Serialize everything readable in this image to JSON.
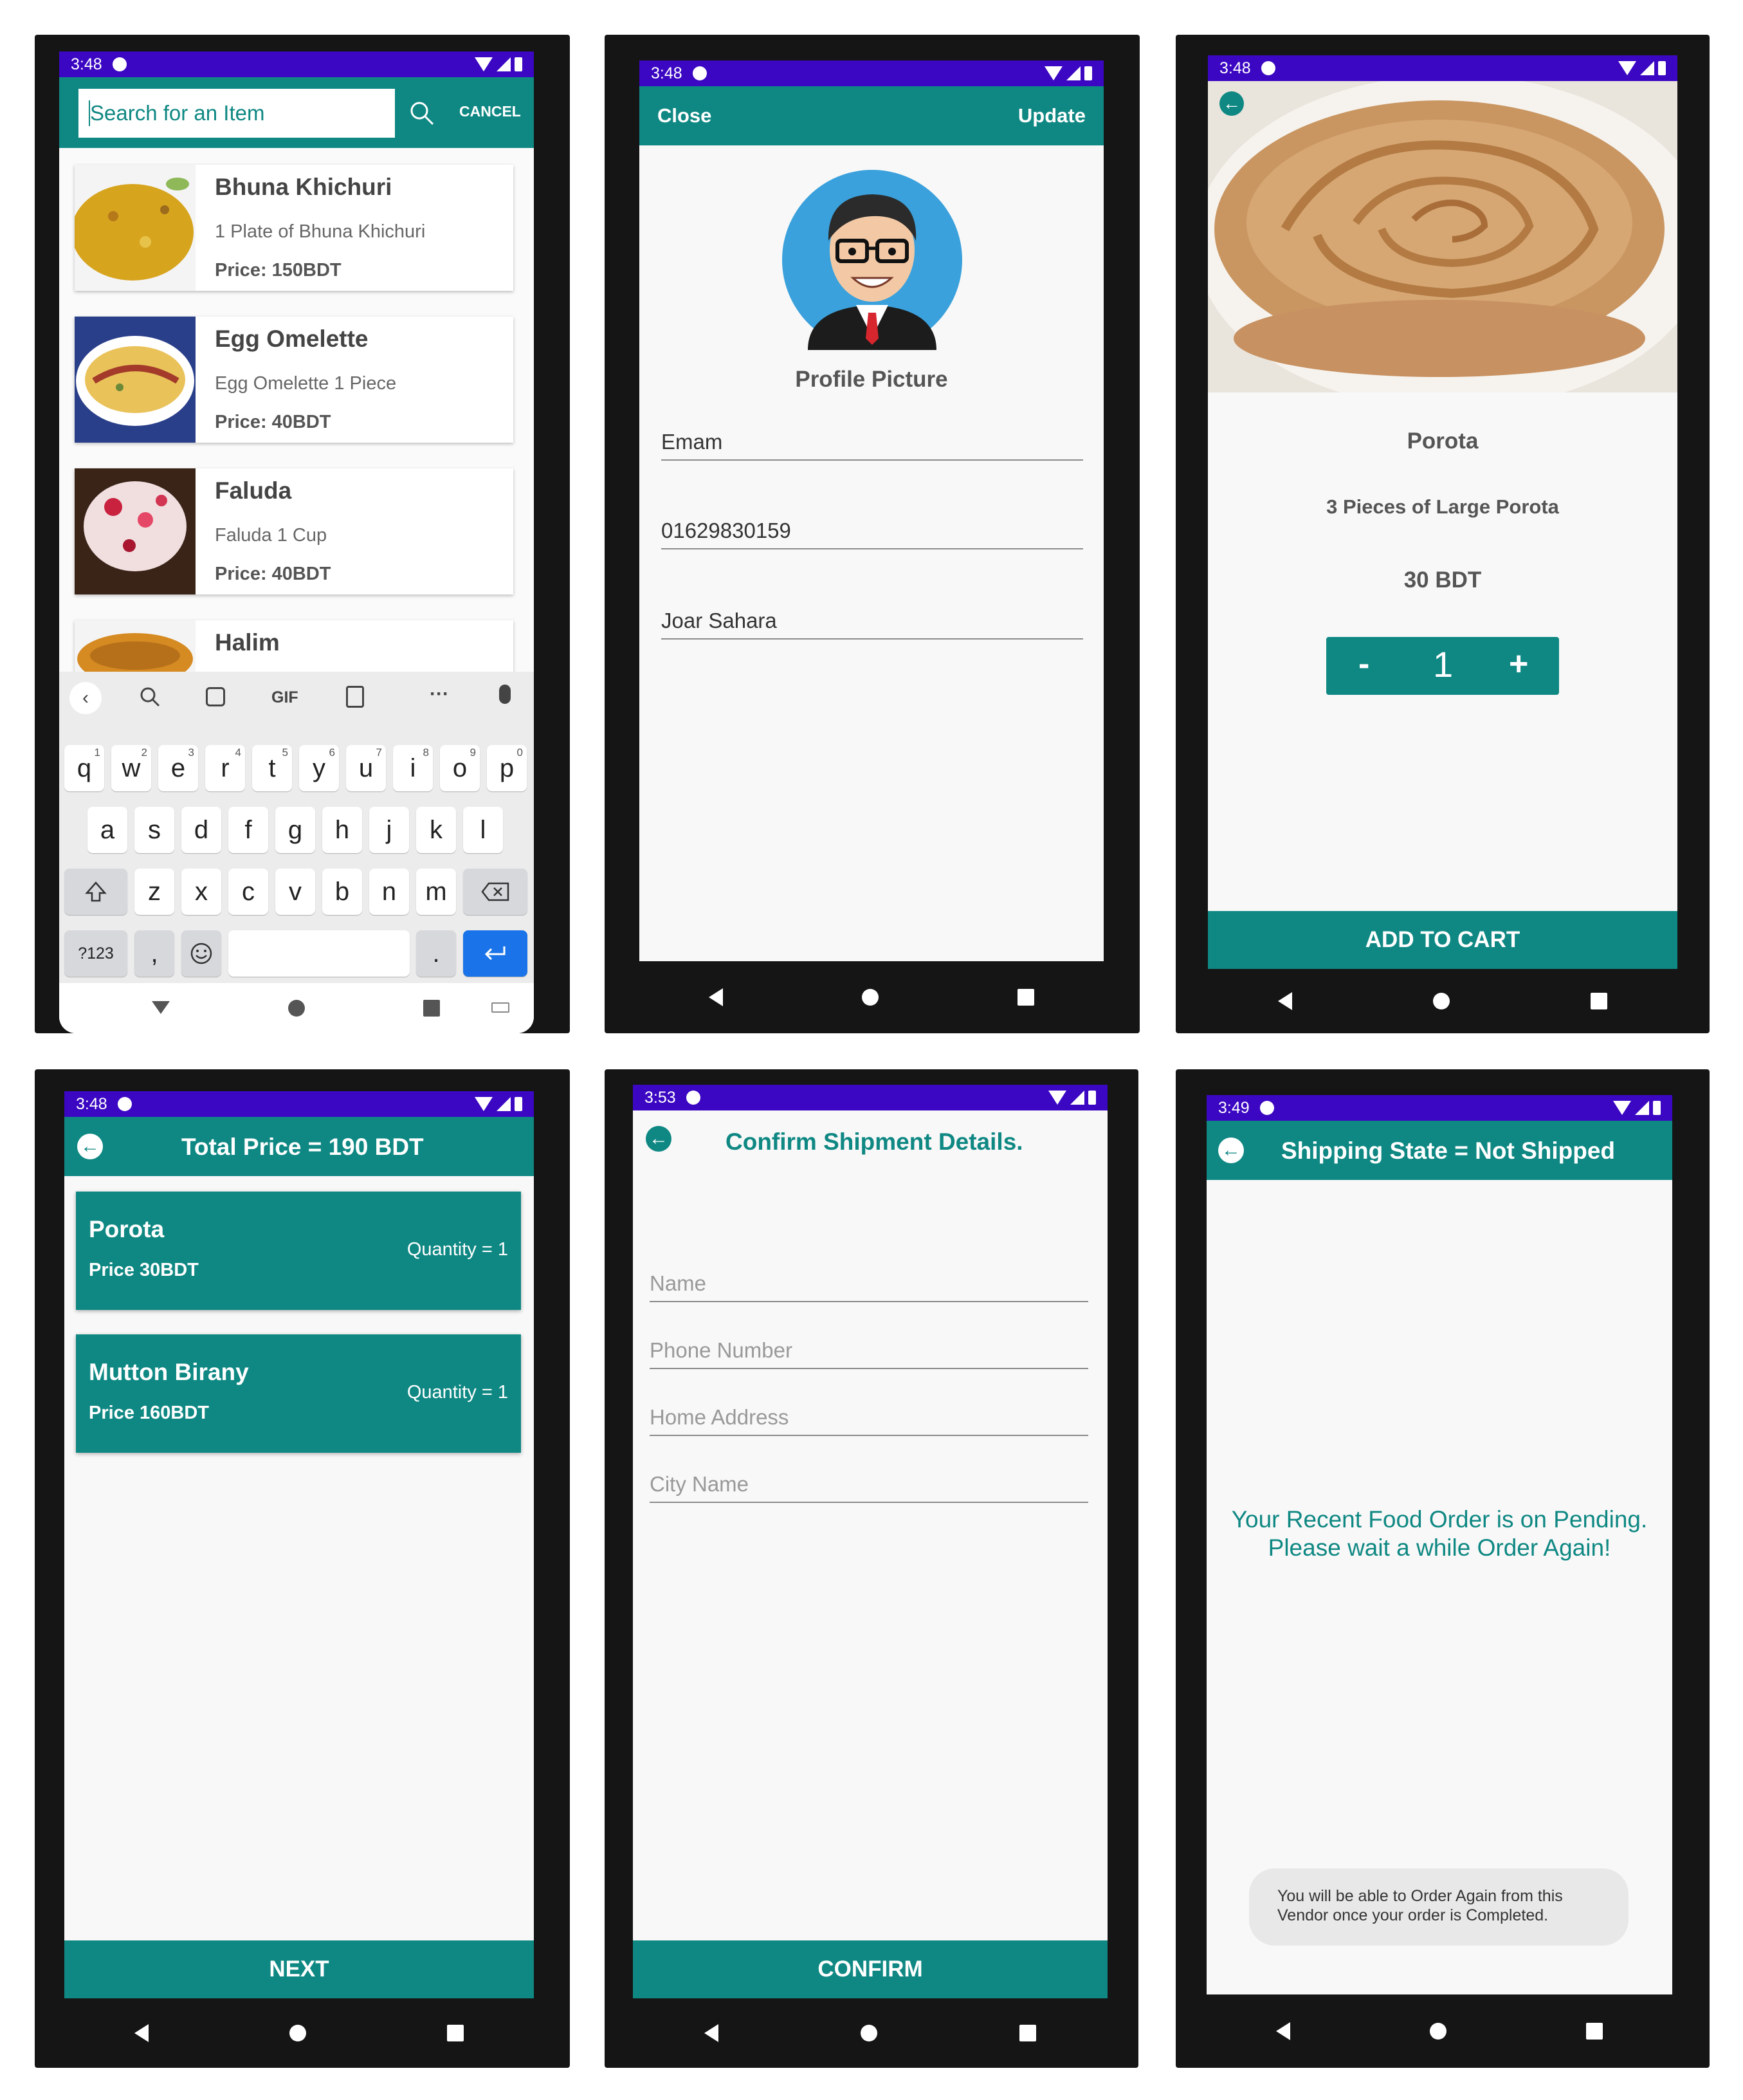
{
  "status": {
    "s1": "3:48",
    "s2": "3:48",
    "s3": "3:48",
    "s4": "3:48",
    "s5": "3:53",
    "s6": "3:49"
  },
  "search_screen": {
    "placeholder": "Search for an Item",
    "cancel_label": "CANCEL",
    "items": [
      {
        "name": "Bhuna Khichuri",
        "desc": "1 Plate of Bhuna Khichuri",
        "price": "Price: 150BDT"
      },
      {
        "name": "Egg Omelette",
        "desc": "Egg Omelette 1 Piece",
        "price": "Price: 40BDT"
      },
      {
        "name": "Faluda",
        "desc": "Faluda 1 Cup",
        "price": "Price: 40BDT"
      },
      {
        "name": "Halim",
        "desc": "",
        "price": ""
      }
    ],
    "keyboard": {
      "toolbar_gif": "GIF",
      "row1": [
        "q",
        "w",
        "e",
        "r",
        "t",
        "y",
        "u",
        "i",
        "o",
        "p"
      ],
      "row1_num": [
        "1",
        "2",
        "3",
        "4",
        "5",
        "6",
        "7",
        "8",
        "9",
        "0"
      ],
      "row2": [
        "a",
        "s",
        "d",
        "f",
        "g",
        "h",
        "j",
        "k",
        "l"
      ],
      "row3": [
        "z",
        "x",
        "c",
        "v",
        "b",
        "n",
        "m"
      ],
      "symbols_label": "?123",
      "comma": ",",
      "period": "."
    }
  },
  "profile_screen": {
    "close_label": "Close",
    "update_label": "Update",
    "picture_label": "Profile Picture",
    "name_value": "Emam",
    "phone_value": "01629830159",
    "address_value": "Joar Sahara"
  },
  "item_screen": {
    "name": "Porota",
    "description": "3 Pieces of Large Porota",
    "price": "30 BDT",
    "minus": "-",
    "quantity": "1",
    "plus": "+",
    "add_to_cart_label": "ADD TO CART"
  },
  "cart_screen": {
    "title": "Total Price = 190 BDT",
    "items": [
      {
        "name": "Porota",
        "price": "Price 30BDT",
        "quantity": "Quantity = 1"
      },
      {
        "name": "Mutton Birany",
        "price": "Price 160BDT",
        "quantity": "Quantity = 1"
      }
    ],
    "next_label": "NEXT"
  },
  "shipment_screen": {
    "title": "Confirm Shipment Details.",
    "name_hint": "Name",
    "phone_hint": "Phone Number",
    "address_hint": "Home Address",
    "city_hint": "City Name",
    "confirm_label": "CONFIRM"
  },
  "shipping_state_screen": {
    "title": "Shipping State = Not Shipped",
    "message_line1": "Your Recent Food Order is on Pending.",
    "message_line2": "Please wait a while Order Again!",
    "toast_line1": "You will be able to Order Again from this",
    "toast_line2": "Vendor once your order is Completed."
  },
  "colors": {
    "teal": "#0f8883",
    "status_bar": "#3b07c2",
    "keyboard_enter": "#1a73e8"
  }
}
